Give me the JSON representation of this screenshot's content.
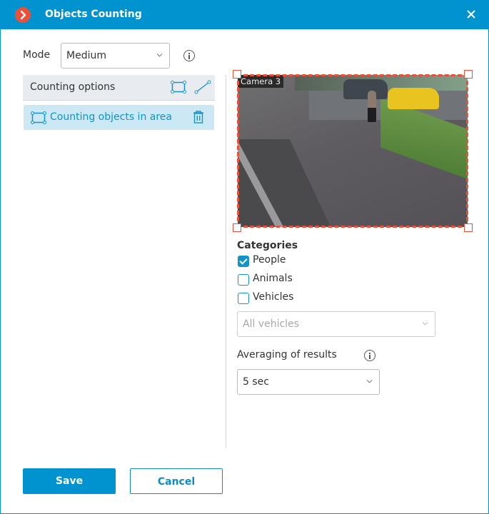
{
  "window": {
    "title": "Objects Counting",
    "close_icon": "close-icon"
  },
  "mode": {
    "label": "Mode",
    "value": "Medium"
  },
  "counting_options": {
    "header": "Counting options",
    "tools": [
      "area-tool-icon",
      "line-tool-icon"
    ],
    "items": [
      {
        "label": "Counting objects in area",
        "icon": "area-icon",
        "selected": true
      }
    ]
  },
  "camera": {
    "label": "Camera 3",
    "zone_color": "#e9513a"
  },
  "categories": {
    "title": "Categories",
    "items": [
      {
        "label": "People",
        "checked": true
      },
      {
        "label": "Animals",
        "checked": false
      },
      {
        "label": "Vehicles",
        "checked": false
      }
    ],
    "vehicles_select": {
      "value": "All vehicles",
      "disabled": true
    }
  },
  "averaging": {
    "label": "Averaging of results",
    "value": "5 sec"
  },
  "footer": {
    "save_label": "Save",
    "cancel_label": "Cancel"
  },
  "colors": {
    "accent": "#0093d0",
    "brand": "#e9513a"
  }
}
